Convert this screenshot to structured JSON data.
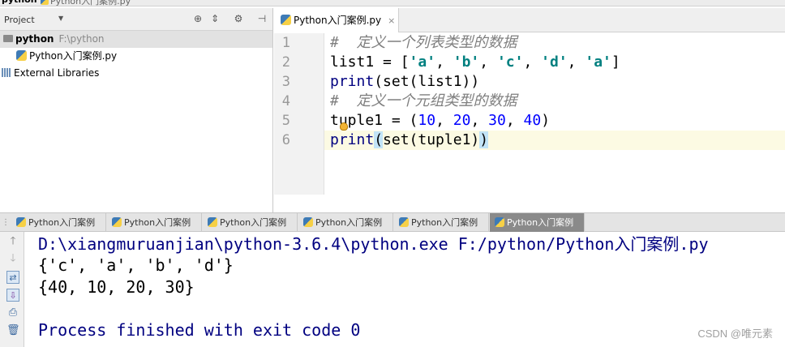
{
  "breadcrumb": {
    "root": "python",
    "file": "Python入门案例.py"
  },
  "project_panel": {
    "title": "Project",
    "tree": [
      {
        "label": "python",
        "path": "F:\\python"
      },
      {
        "label": "Python入门案例.py"
      },
      {
        "label": "External Libraries"
      }
    ]
  },
  "editor": {
    "tab_label": "Python入门案例.py",
    "tab_close": "×",
    "line_numbers": [
      "1",
      "2",
      "3",
      "4",
      "5",
      "6"
    ],
    "code": {
      "l1": "#  定义一个列表类型的数据",
      "l2_a": "list1 = [",
      "l2_s1": "'a'",
      "l2_s2": "'b'",
      "l2_s3": "'c'",
      "l2_s4": "'d'",
      "l2_s5": "'a'",
      "l2_end": "]",
      "l3_kw": "print",
      "l3_rest": "(set(list1))",
      "l4": "#  定义一个元组类型的数据",
      "l5_a": "tuple1 = (",
      "l5_n1": "10",
      "l5_n2": "20",
      "l5_n3": "30",
      "l5_n4": "40",
      "l5_end": ")",
      "l6_kw": "print",
      "l6_open": "(",
      "l6_mid": "set(tuple1)",
      "l6_close": ")"
    },
    "comma_sep": ", "
  },
  "run_tabs": [
    {
      "label": "Python入门案例"
    },
    {
      "label": "Python入门案例"
    },
    {
      "label": "Python入门案例"
    },
    {
      "label": "Python入门案例"
    },
    {
      "label": "Python入门案例"
    },
    {
      "label": "Python入门案例",
      "active": true
    }
  ],
  "console": {
    "command": "D:\\xiangmuruanjian\\python-3.6.4\\python.exe F:/python/Python入门案例.py",
    "output1": "{'c', 'a', 'b', 'd'}",
    "output2": "{40, 10, 20, 30}",
    "exit": "Process finished with exit code 0"
  },
  "watermark": "CSDN @唯元素",
  "colors": {
    "keyword": "#000080",
    "string": "#008080",
    "number": "#0000ff",
    "comment": "#7f7f7f",
    "current_line": "#fcfae3"
  }
}
